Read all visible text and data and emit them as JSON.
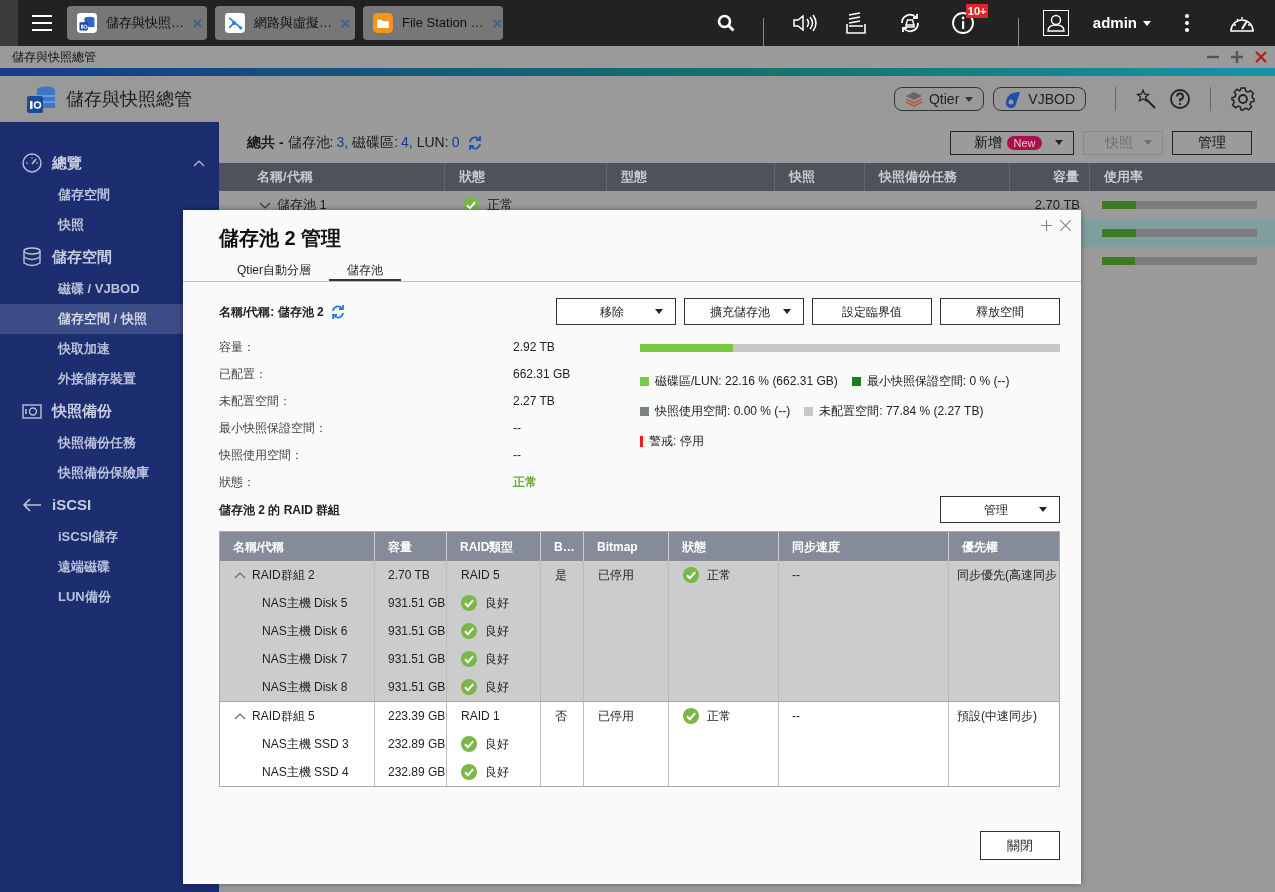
{
  "taskbar": {
    "tabs": [
      {
        "label": "儲存與快照…"
      },
      {
        "label": "網路與虛擬…"
      },
      {
        "label": "File Station …"
      }
    ],
    "notification_badge": "10+",
    "user": "admin"
  },
  "window": {
    "title": "儲存與快照總管"
  },
  "app": {
    "title": "儲存與快照總管",
    "buttons": [
      {
        "label": "Qtier",
        "dropdown": true
      },
      {
        "label": "VJBOD",
        "dropdown": false
      }
    ]
  },
  "sidebar": {
    "sections": [
      {
        "label": "總覽",
        "items": [
          {
            "label": "儲存空間",
            "selected": false
          },
          {
            "label": "快照",
            "selected": false
          }
        ]
      },
      {
        "label": "儲存空間",
        "items": [
          {
            "label": "磁碟 / VJBOD",
            "selected": false
          },
          {
            "label": "儲存空間 / 快照",
            "selected": true
          },
          {
            "label": "快取加速",
            "selected": false
          },
          {
            "label": "外接儲存裝置",
            "selected": false
          }
        ]
      },
      {
        "label": "快照備份",
        "items": [
          {
            "label": "快照備份任務",
            "selected": false
          },
          {
            "label": "快照備份保險庫",
            "selected": false
          }
        ]
      },
      {
        "label": "iSCSI",
        "items": [
          {
            "label": "iSCSI儲存",
            "selected": false
          },
          {
            "label": "遠端磁碟",
            "selected": false
          },
          {
            "label": "LUN備份",
            "selected": false
          }
        ]
      }
    ]
  },
  "summary": {
    "label": "總共 -",
    "counts": [
      {
        "label": "儲存池:",
        "value": "3,"
      },
      {
        "label": "磁碟區:",
        "value": "4,"
      },
      {
        "label": "LUN:",
        "value": "0"
      }
    ]
  },
  "toolbar": [
    {
      "label": "新增",
      "badge": "New",
      "dropdown": true,
      "disabled": false
    },
    {
      "label": "快照",
      "dropdown": true,
      "disabled": true
    },
    {
      "label": "管理",
      "dropdown": false,
      "disabled": false
    }
  ],
  "pools_table": {
    "columns": [
      "名稱/代稱",
      "狀態",
      "型態",
      "快照",
      "快照備份任務",
      "容量",
      "使用率"
    ],
    "rows": [
      {
        "name": "儲存池 1",
        "status": "正常",
        "capacity": "2.70 TB",
        "level": 0.22,
        "selected": false
      },
      {
        "level": 0.22,
        "selected": true
      },
      {
        "level": 0.21,
        "selected": false
      }
    ]
  },
  "dialog": {
    "title": "儲存池 2 管理",
    "tabs": [
      {
        "label": "Qtier自動分層",
        "selected": false
      },
      {
        "label": "儲存池",
        "selected": true
      }
    ],
    "name_label": "名稱/代稱: 儲存池 2",
    "actions": [
      {
        "label": "移除",
        "dropdown": true
      },
      {
        "label": "擴充儲存池",
        "dropdown": true
      },
      {
        "label": "設定臨界值",
        "dropdown": false
      },
      {
        "label": "釋放空間",
        "dropdown": false
      }
    ],
    "details": [
      {
        "label": "容量：",
        "value": "2.92 TB",
        "kind": "plain"
      },
      {
        "label": "已配置：",
        "value": "662.31 GB",
        "kind": "plain"
      },
      {
        "label": "未配置空間：",
        "value": "2.27 TB",
        "kind": "plain"
      },
      {
        "label": "最小快照保證空間：",
        "value": "--",
        "kind": "plain"
      },
      {
        "label": "快照使用空間：",
        "value": "--",
        "kind": "plain"
      },
      {
        "label": "狀態：",
        "value": "正常",
        "kind": "status"
      }
    ],
    "usage": {
      "level": 0.2216
    },
    "legend": [
      {
        "label": "磁碟區/LUN: 22.16 % (662.31 GB)",
        "color": "#7ac943",
        "kind": "square"
      },
      {
        "label": "最小快照保證空間: 0 % (--)",
        "color": "#1e7b1e",
        "kind": "square"
      },
      {
        "label": "快照使用空間: 0.00 % (--)",
        "color": "#7a847a",
        "kind": "square"
      },
      {
        "label": "未配置空間: 77.84 % (2.27 TB)",
        "color": "#c8c8c8",
        "kind": "square"
      },
      {
        "label": "警戒: 停用",
        "color": "#ee1c1c",
        "kind": "line"
      }
    ],
    "raid_title": "儲存池 2 的 RAID 群組",
    "raid_manage": {
      "label": "管理",
      "dropdown": true
    },
    "raid_table": {
      "columns": [
        "名稱/代稱",
        "容量",
        "RAID類型",
        "B…",
        "Bitmap",
        "狀態",
        "同步速度",
        "優先權"
      ],
      "groups": [
        {
          "name": "RAID群組 2",
          "capacity": "2.70 TB",
          "raid_type": "RAID 5",
          "column_4": "是",
          "bitmap": "已停用",
          "status": "正常",
          "sync_speed": "--",
          "priority": "同步優先(高速同步",
          "expanded": true,
          "selected": true,
          "children": [
            {
              "name": "NAS主機 Disk 5",
              "capacity": "931.51 GB",
              "status": "良好"
            },
            {
              "name": "NAS主機 Disk 6",
              "capacity": "931.51 GB",
              "status": "良好"
            },
            {
              "name": "NAS主機 Disk 7",
              "capacity": "931.51 GB",
              "status": "良好"
            },
            {
              "name": "NAS主機 Disk 8",
              "capacity": "931.51 GB",
              "status": "良好"
            }
          ]
        },
        {
          "name": "RAID群組 5",
          "capacity": "223.39 GB",
          "raid_type": "RAID 1",
          "column_4": "否",
          "bitmap": "已停用",
          "status": "正常",
          "sync_speed": "--",
          "priority": "預設(中速同步)",
          "expanded": true,
          "selected": false,
          "children": [
            {
              "name": "NAS主機 SSD 3",
              "capacity": "232.89 GB",
              "status": "良好"
            },
            {
              "name": "NAS主機 SSD 4",
              "capacity": "232.89 GB",
              "status": "良好"
            }
          ]
        }
      ]
    },
    "close": "關閉"
  }
}
